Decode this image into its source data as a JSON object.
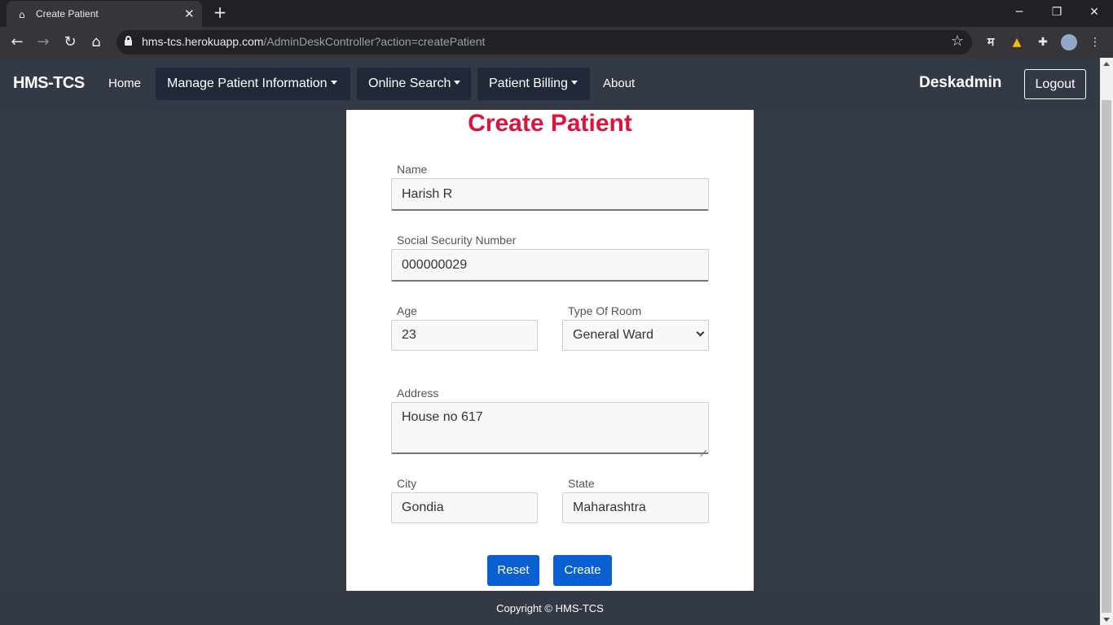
{
  "browser": {
    "tab_title": "Create Patient",
    "url_host": "hms-tcs.herokuapp.com",
    "url_path": "/AdminDeskController?action=createPatient",
    "ext_hindi_glyph": "म"
  },
  "navbar": {
    "brand": "HMS-TCS",
    "home": "Home",
    "manage": "Manage Patient Information",
    "search": "Online Search",
    "billing": "Patient Billing",
    "about": "About",
    "user": "Deskadmin",
    "logout": "Logout"
  },
  "form": {
    "title": "Create Patient",
    "name_label": "Name",
    "name_value": "Harish R",
    "ssn_label": "Social Security Number",
    "ssn_value": "000000029",
    "age_label": "Age",
    "age_value": "23",
    "room_label": "Type Of Room",
    "room_value": "General Ward",
    "address_label": "Address",
    "address_value": "House no 617",
    "city_label": "City",
    "city_value": "Gondia",
    "state_label": "State",
    "state_value": "Maharashtra",
    "reset": "Reset",
    "create": "Create"
  },
  "footer": {
    "copyright": "Copyright © HMS-TCS"
  },
  "colors": {
    "title": "#dc143c",
    "button": "#0a5fd3",
    "page_bg": "#353b45"
  }
}
